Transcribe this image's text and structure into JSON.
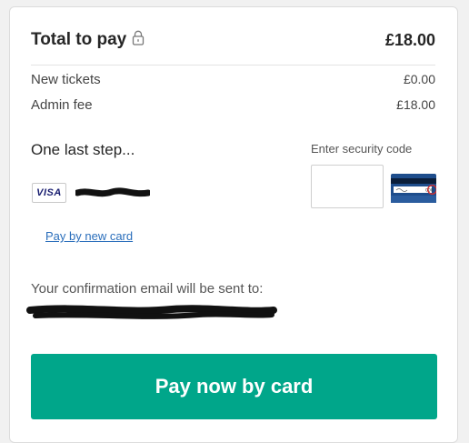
{
  "summary": {
    "total_label": "Total to pay",
    "total_amount": "£18.00",
    "lines": [
      {
        "label": "New tickets",
        "value": "£0.00"
      },
      {
        "label": "Admin fee",
        "value": "£18.00"
      }
    ]
  },
  "payment": {
    "step_title": "One last step...",
    "card_brand": "VISA",
    "card_number_masked": "",
    "security_code_label": "Enter security code",
    "security_code_value": "",
    "new_card_link": "Pay by new card"
  },
  "confirmation": {
    "text": "Your confirmation email will be sent to:",
    "email": ""
  },
  "actions": {
    "pay_button_label": "Pay now by card"
  },
  "colors": {
    "accent": "#00a68a",
    "link": "#2a6ebb",
    "visa_blue": "#1a1f71"
  }
}
